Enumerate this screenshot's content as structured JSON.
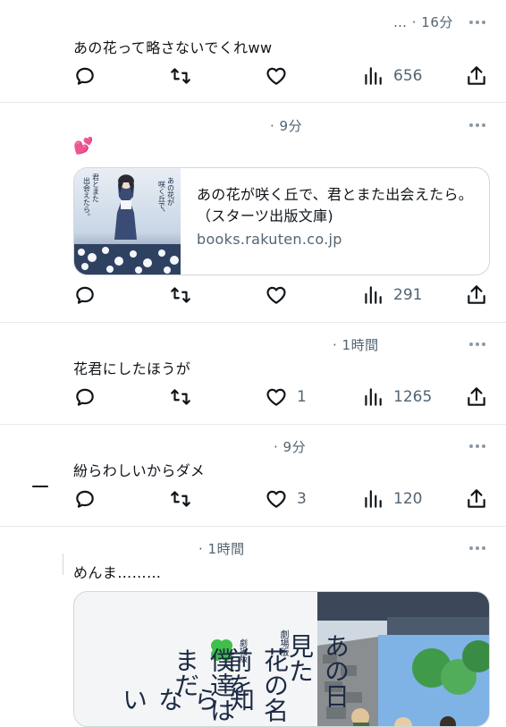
{
  "tweets": [
    {
      "meta": "… · 16分",
      "text": "あの花って略さないでくれww",
      "likes": "",
      "views": "656"
    },
    {
      "meta": "· 9分",
      "emoji": "💕",
      "card": {
        "title": "あの花が咲く丘で、君とまた出会えたら。 （スターツ出版文庫)",
        "domain": "books.rakuten.co.jp",
        "cover_text": "あの花が咲く丘で、君とまた出会えたら。"
      },
      "likes": "",
      "views": "291"
    },
    {
      "meta": "· 1時間",
      "text": "花君にしたほうが",
      "likes": "1",
      "views": "1265"
    },
    {
      "meta": "· 9分",
      "text": "紛らわしいからダメ",
      "likes": "3",
      "views": "120"
    },
    {
      "meta": "· 1時間",
      "text": "めんま………",
      "media": {
        "label": "劇場版",
        "title_col1": "あの日見た",
        "title_col2": "花の名前を",
        "title_col3": "僕達はまだ",
        "title_col4": "知らない"
      }
    }
  ],
  "colors": {
    "secondary_text": "#536471",
    "divider": "#e6e9ec",
    "heart_emoji": "#ff4fa3",
    "clover": "#3fbf4a"
  },
  "icons": [
    "reply-icon",
    "retweet-icon",
    "like-icon",
    "views-icon",
    "share-icon",
    "more-icon"
  ]
}
